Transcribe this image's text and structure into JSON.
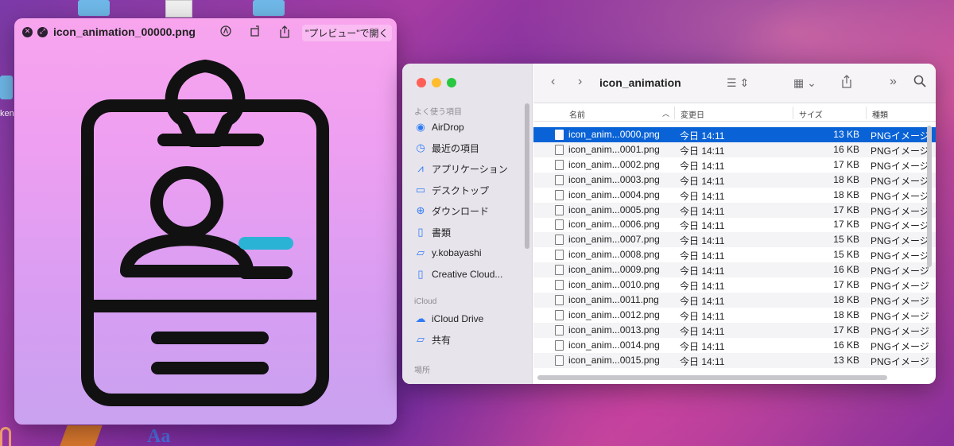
{
  "desktop": {
    "partial_label": "ken"
  },
  "preview": {
    "title": "icon_animation_00000.png",
    "open_with_label": "\"プレビュー\"で開く",
    "colors": {
      "stroke": "#111111",
      "accent": "#2bb3d6"
    }
  },
  "finder": {
    "toolbar": {
      "title": "icon_animation"
    },
    "sidebar": {
      "favorites_header": "よく使う項目",
      "favorites": [
        {
          "label": "AirDrop",
          "icon": "airdrop-icon"
        },
        {
          "label": "最近の項目",
          "icon": "clock-icon"
        },
        {
          "label": "アプリケーション",
          "icon": "applications-icon"
        },
        {
          "label": "デスクトップ",
          "icon": "desktop-icon"
        },
        {
          "label": "ダウンロード",
          "icon": "download-icon"
        },
        {
          "label": "書類",
          "icon": "document-icon"
        },
        {
          "label": "y.kobayashi",
          "icon": "folder-icon"
        },
        {
          "label": "Creative Cloud...",
          "icon": "file-icon"
        }
      ],
      "icloud_header": "iCloud",
      "icloud": [
        {
          "label": "iCloud Drive",
          "icon": "cloud-icon"
        },
        {
          "label": "共有",
          "icon": "shared-folder-icon"
        }
      ],
      "locations_header": "場所"
    },
    "columns": {
      "name": "名前",
      "date": "変更日",
      "size": "サイズ",
      "kind": "種類"
    },
    "files": [
      {
        "name": "icon_anim...0000.png",
        "date": "今日 14:11",
        "size": "13 KB",
        "kind": "PNGイメージ"
      },
      {
        "name": "icon_anim...0001.png",
        "date": "今日 14:11",
        "size": "16 KB",
        "kind": "PNGイメージ"
      },
      {
        "name": "icon_anim...0002.png",
        "date": "今日 14:11",
        "size": "17 KB",
        "kind": "PNGイメージ"
      },
      {
        "name": "icon_anim...0003.png",
        "date": "今日 14:11",
        "size": "18 KB",
        "kind": "PNGイメージ"
      },
      {
        "name": "icon_anim...0004.png",
        "date": "今日 14:11",
        "size": "18 KB",
        "kind": "PNGイメージ"
      },
      {
        "name": "icon_anim...0005.png",
        "date": "今日 14:11",
        "size": "17 KB",
        "kind": "PNGイメージ"
      },
      {
        "name": "icon_anim...0006.png",
        "date": "今日 14:11",
        "size": "17 KB",
        "kind": "PNGイメージ"
      },
      {
        "name": "icon_anim...0007.png",
        "date": "今日 14:11",
        "size": "15 KB",
        "kind": "PNGイメージ"
      },
      {
        "name": "icon_anim...0008.png",
        "date": "今日 14:11",
        "size": "15 KB",
        "kind": "PNGイメージ"
      },
      {
        "name": "icon_anim...0009.png",
        "date": "今日 14:11",
        "size": "16 KB",
        "kind": "PNGイメージ"
      },
      {
        "name": "icon_anim...0010.png",
        "date": "今日 14:11",
        "size": "17 KB",
        "kind": "PNGイメージ"
      },
      {
        "name": "icon_anim...0011.png",
        "date": "今日 14:11",
        "size": "18 KB",
        "kind": "PNGイメージ"
      },
      {
        "name": "icon_anim...0012.png",
        "date": "今日 14:11",
        "size": "18 KB",
        "kind": "PNGイメージ"
      },
      {
        "name": "icon_anim...0013.png",
        "date": "今日 14:11",
        "size": "17 KB",
        "kind": "PNGイメージ"
      },
      {
        "name": "icon_anim...0014.png",
        "date": "今日 14:11",
        "size": "16 KB",
        "kind": "PNGイメージ"
      },
      {
        "name": "icon_anim...0015.png",
        "date": "今日 14:11",
        "size": "13 KB",
        "kind": "PNGイメージ"
      }
    ],
    "selected_index": 0
  }
}
